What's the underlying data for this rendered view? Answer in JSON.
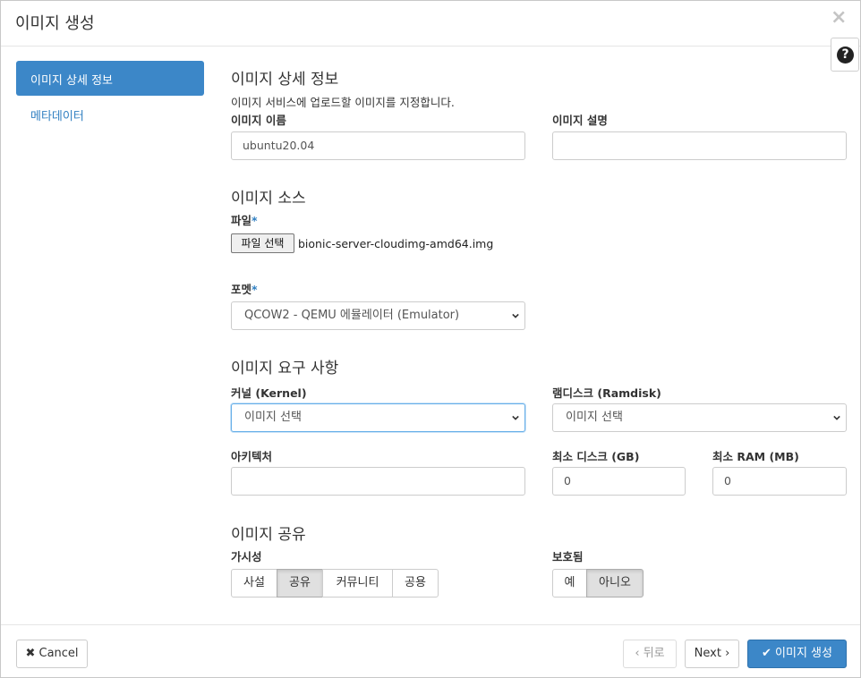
{
  "dialog": {
    "title": "이미지 생성",
    "close_glyph": "×",
    "help_glyph": "?"
  },
  "sidebar": {
    "items": [
      {
        "label": "이미지 상세 정보",
        "active": true
      },
      {
        "label": "메타데이터",
        "active": false
      }
    ]
  },
  "details": {
    "title": "이미지 상세 정보",
    "description": "이미지 서비스에 업로드할 이미지를 지정합니다.",
    "name_label": "이미지 이름",
    "name_value": "ubuntu20.04",
    "desc_label": "이미지 설명",
    "desc_value": ""
  },
  "source": {
    "title": "이미지 소스",
    "file_label": "파일",
    "required_mark": "*",
    "file_button": "파일 선택",
    "file_name": "bionic-server-cloudimg-amd64.img",
    "format_label": "포멧",
    "format_value": "QCOW2 - QEMU 에뮬레이터 (Emulator)"
  },
  "requirements": {
    "title": "이미지 요구 사항",
    "kernel_label": "커널 (Kernel)",
    "kernel_value": "이미지 선택",
    "ramdisk_label": "램디스크 (Ramdisk)",
    "ramdisk_value": "이미지 선택",
    "arch_label": "아키텍처",
    "arch_value": "",
    "min_disk_label": "최소 디스크 (GB)",
    "min_disk_value": "0",
    "min_ram_label": "최소 RAM (MB)",
    "min_ram_value": "0"
  },
  "sharing": {
    "title": "이미지 공유",
    "visibility_label": "가시성",
    "visibility_options": [
      "사설",
      "공유",
      "커뮤니티",
      "공용"
    ],
    "visibility_selected": "공유",
    "protected_label": "보호됨",
    "protected_options": [
      "예",
      "아니오"
    ],
    "protected_selected": "아니오"
  },
  "footer": {
    "cancel": "Cancel",
    "back": "뒤로",
    "next": "Next",
    "create": "이미지 생성"
  },
  "colors": {
    "primary": "#3c87c8",
    "link": "#2f7fc1",
    "focus": "#66afe9"
  }
}
